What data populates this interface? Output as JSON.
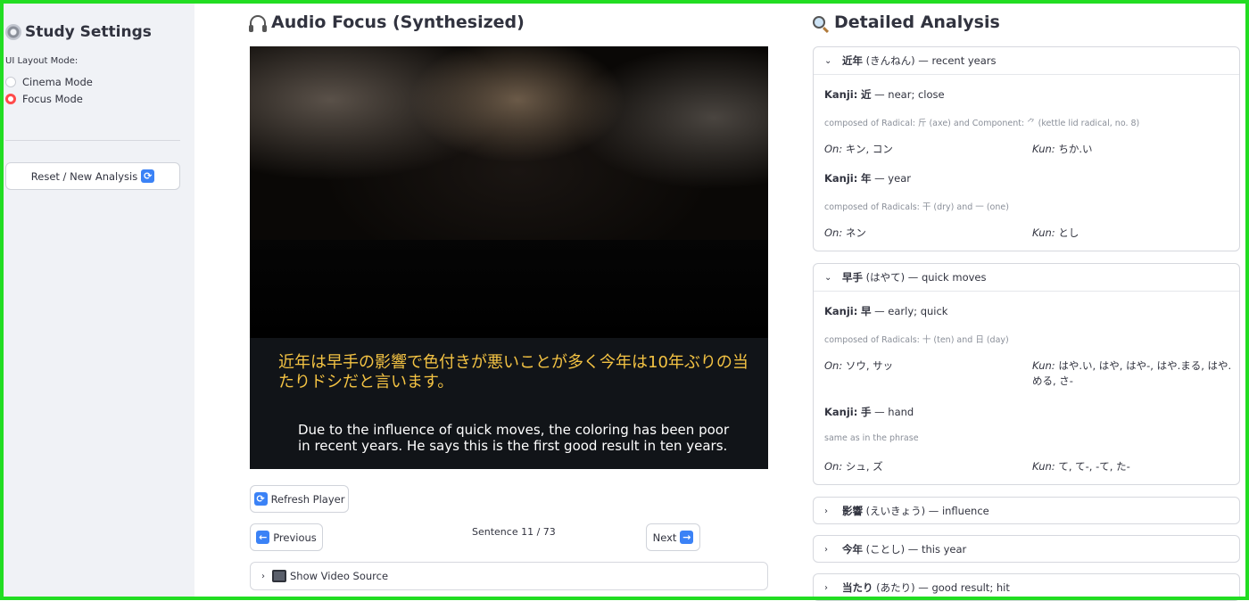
{
  "sidebar": {
    "title": "Study Settings",
    "layout_label": "UI Layout Mode:",
    "modes": [
      {
        "label": "Cinema Mode",
        "selected": false
      },
      {
        "label": "Focus Mode",
        "selected": true
      }
    ],
    "reset_label": "Reset / New Analysis"
  },
  "player": {
    "title": "Audio Focus (Synthesized)",
    "subtitle_jp": "近年は早手の影響で色付きが悪いことが多く今年は10年ぶりの当たりドシだと言います。",
    "subtitle_en": "Due to the influence of quick moves, the coloring has been poor in recent years. He says this is the first good result in ten years.",
    "refresh_label": "Refresh Player",
    "previous_label": "Previous",
    "next_label": "Next",
    "sentence_counter": "Sentence 11 / 73",
    "video_source_label": "Show Video Source"
  },
  "analysis": {
    "title": "Detailed Analysis",
    "entries": [
      {
        "word": "近年",
        "reading": "(きんねん)",
        "meaning": "— recent years",
        "expanded": true,
        "kanji": [
          {
            "prefix": "Kanji:",
            "char": "近",
            "meaning": "— near; close",
            "composition": "composed of Radical: 斤 (axe) and Component: ⺈ (kettle lid radical, no. 8)",
            "on_label": "On:",
            "on": "キン, コン",
            "kun_label": "Kun:",
            "kun": "ちか.い"
          },
          {
            "prefix": "Kanji:",
            "char": "年",
            "meaning": "— year",
            "composition": "composed of Radicals: 干 (dry) and 一 (one)",
            "on_label": "On:",
            "on": "ネン",
            "kun_label": "Kun:",
            "kun": "とし"
          }
        ]
      },
      {
        "word": "早手",
        "reading": "(はやて)",
        "meaning": "— quick moves",
        "expanded": true,
        "kanji": [
          {
            "prefix": "Kanji:",
            "char": "早",
            "meaning": "— early; quick",
            "composition": "composed of Radicals: 十 (ten) and 日 (day)",
            "on_label": "On:",
            "on": "ソウ, サッ",
            "kun_label": "Kun:",
            "kun": "はや.い, はや, はや-, はや.まる, はや.める, さ-"
          },
          {
            "prefix": "Kanji:",
            "char": "手",
            "meaning": "— hand",
            "composition": "same as in the phrase",
            "on_label": "On:",
            "on": "シュ, ズ",
            "kun_label": "Kun:",
            "kun": "て, て-, -て, た-"
          }
        ]
      },
      {
        "word": "影響",
        "reading": "(えいきょう)",
        "meaning": "— influence",
        "expanded": false
      },
      {
        "word": "今年",
        "reading": "(ことし)",
        "meaning": "— this year",
        "expanded": false
      },
      {
        "word": "当たり",
        "reading": "(あたり)",
        "meaning": "— good result; hit",
        "expanded": false
      }
    ]
  },
  "colors": {
    "accent_radio": "#ff4b4b",
    "subtitle_jp": "#f4c343",
    "frame": "#22dd22"
  },
  "icons": {
    "settings": "gear-icon",
    "audio": "headphones-icon",
    "analysis": "magnifier-icon",
    "refresh": "refresh-icon",
    "previous": "left-arrow-icon",
    "next": "right-arrow-icon",
    "video": "tv-icon"
  }
}
